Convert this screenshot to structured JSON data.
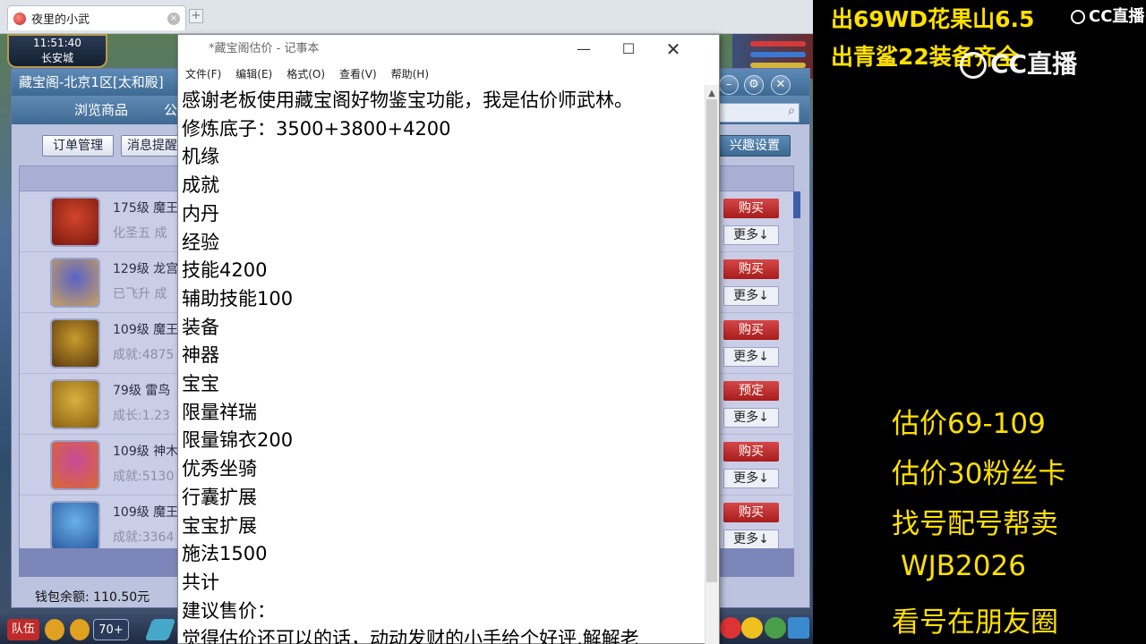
{
  "browser": {
    "tab_title": "夜里的小武",
    "tab_close": "×",
    "new_tab": "+"
  },
  "game": {
    "clock": "11:51:40",
    "location": "长安城",
    "bottom": {
      "team": "队伍",
      "chat_count": "70+"
    }
  },
  "store": {
    "title": "藏宝阁-北京1区[太和殿]",
    "nav_browse": "浏览商品",
    "nav_next": "公",
    "btn_orders": "订单管理",
    "btn_messages": "消息提醒",
    "btn_interest": "兴趣设置",
    "wallet": "钱包余额: 110.50元",
    "items": [
      {
        "line1": "175级 魔王",
        "line2": "化圣五 成",
        "action": "购买",
        "more": "更多↓"
      },
      {
        "line1": "129级 龙宫",
        "line2": "已飞升 成",
        "action": "购买",
        "more": "更多↓"
      },
      {
        "line1": "109级 魔王",
        "line2": "成就:4875",
        "action": "购买",
        "more": "更多↓"
      },
      {
        "line1": "79级 雷鸟",
        "line2": "成长:1.23",
        "action": "预定",
        "more": "更多↓"
      },
      {
        "line1": "109级 神木",
        "line2": "成就:5130",
        "action": "购买",
        "more": "更多↓"
      },
      {
        "line1": "109级 魔王",
        "line2": "成就:3364",
        "action": "购买",
        "more": "更多↓"
      }
    ]
  },
  "notepad": {
    "title": "*藏宝阁估价 - 记事本",
    "menu": [
      "文件(F)",
      "编辑(E)",
      "格式(O)",
      "查看(V)",
      "帮助(H)"
    ],
    "lines": [
      "感谢老板使用藏宝阁好物鉴宝功能，我是估价师武林。",
      "修炼底子：3500+3800+4200",
      "机缘",
      "成就",
      "内丹",
      "经验",
      "技能4200",
      "辅助技能100",
      "装备",
      "神器",
      "宝宝",
      "限量祥瑞",
      "限量锦衣200",
      "优秀坐骑",
      "行囊扩展",
      "宝宝扩展",
      "施法1500",
      "共计",
      "建议售价：",
      "觉得估价还可以的话，动动发财的小手给个好评,解解老"
    ]
  },
  "overlay": {
    "top1": "出69WD花果山6.5",
    "top2": "出青鲨22装备齐全",
    "cc_logo": "CC直播",
    "lines": [
      "估价69-109",
      "估价30粉丝卡",
      "找号配号帮卖",
      "WJB2026",
      "看号在朋友圈"
    ]
  }
}
